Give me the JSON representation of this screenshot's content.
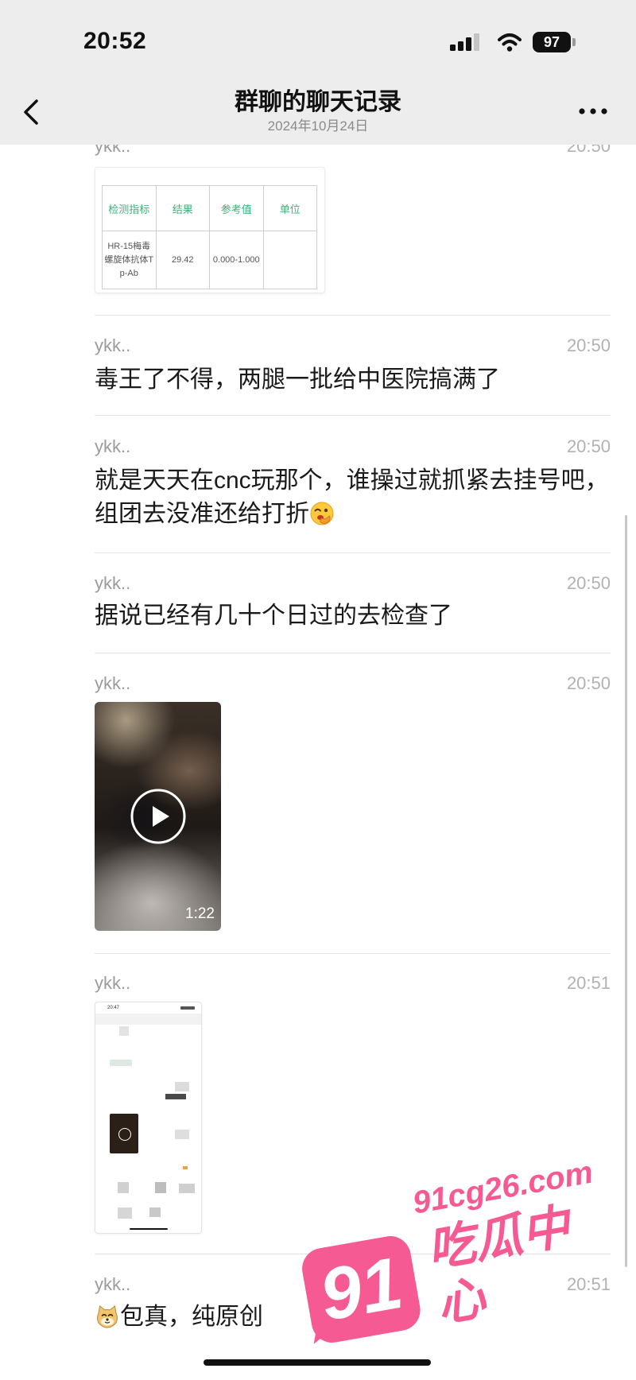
{
  "status_bar": {
    "time": "20:52",
    "battery": "97",
    "icons": [
      "signal-icon",
      "wifi-icon",
      "battery-icon"
    ]
  },
  "nav": {
    "title": "群聊的聊天记录",
    "subtitle": "2024年10月24日",
    "back_icon": "chevron-left-icon",
    "more_icon": "more-dots-icon"
  },
  "messages": [
    {
      "sender": "ykk..",
      "time": "20:50",
      "table": {
        "headers": [
          "检测指标",
          "结果",
          "参考值",
          "单位"
        ],
        "rows": [
          [
            "HR-15梅毒螺旋体抗体Tp-Ab",
            "29.42",
            "0.000-1.000",
            ""
          ]
        ]
      }
    },
    {
      "sender": "ykk..",
      "time": "20:50",
      "text": "毒王了不得，两腿一批给中医院搞满了"
    },
    {
      "sender": "ykk..",
      "time": "20:50",
      "text": "就是天天在cnc玩那个，谁操过就抓紧去挂号吧，组团去没准还给打折",
      "emoji_icon": "face-with-hand-emoji-icon"
    },
    {
      "sender": "ykk..",
      "time": "20:50",
      "text": "据说已经有几十个日过的去检查了"
    },
    {
      "sender": "ykk..",
      "time": "20:50",
      "video": {
        "duration": "1:22",
        "icon": "play-icon"
      }
    },
    {
      "sender": "ykk..",
      "time": "20:51",
      "screenshot": {
        "status_time": "20:47"
      }
    },
    {
      "sender": "ykk..",
      "time": "20:51",
      "text": "包真，纯原创",
      "emoji_icon": "cat-face-emoji-icon"
    }
  ],
  "watermark": {
    "logo": "91",
    "site": "91cg26.com",
    "name": "吃瓜中心",
    "color": "#f65a93"
  },
  "colors": {
    "header_bg": "#ededed",
    "table_header": "#3cb37a",
    "meta_text": "#9b9b9b"
  }
}
